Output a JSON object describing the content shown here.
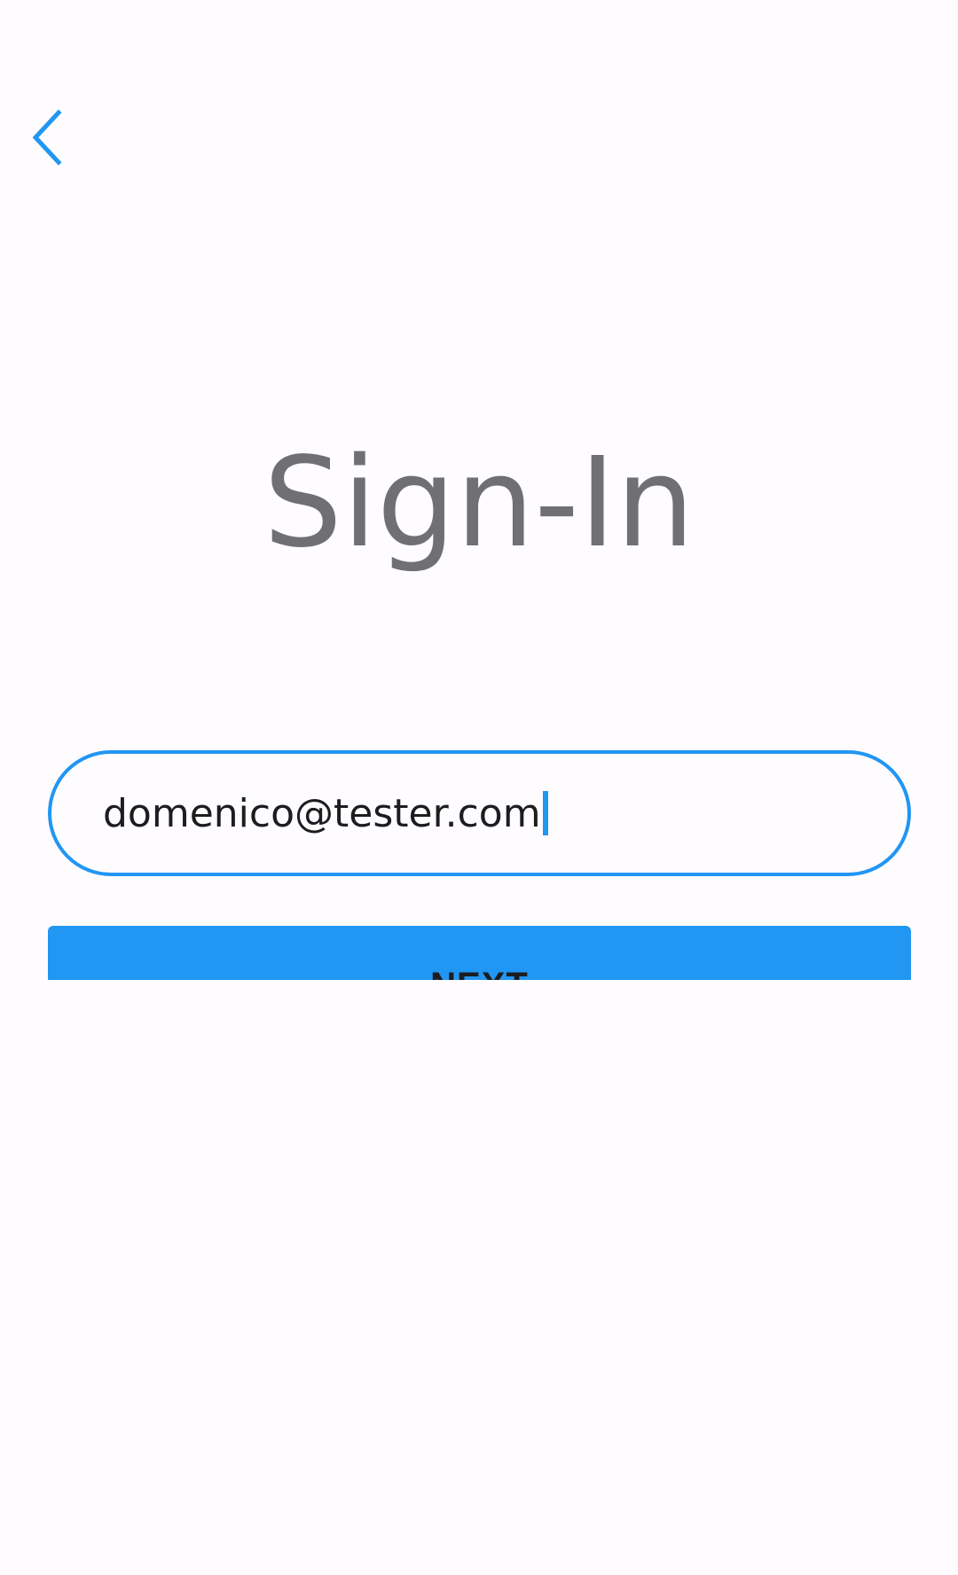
{
  "header": {
    "back_icon": "chevron-left-icon"
  },
  "page": {
    "title": "Sign-In"
  },
  "form": {
    "email_value": "domenico@tester.com",
    "next_label": "NEXT"
  },
  "colors": {
    "accent": "#2196f3",
    "title": "#707074",
    "background": "#fefcfe",
    "text": "#1d1d1f"
  }
}
